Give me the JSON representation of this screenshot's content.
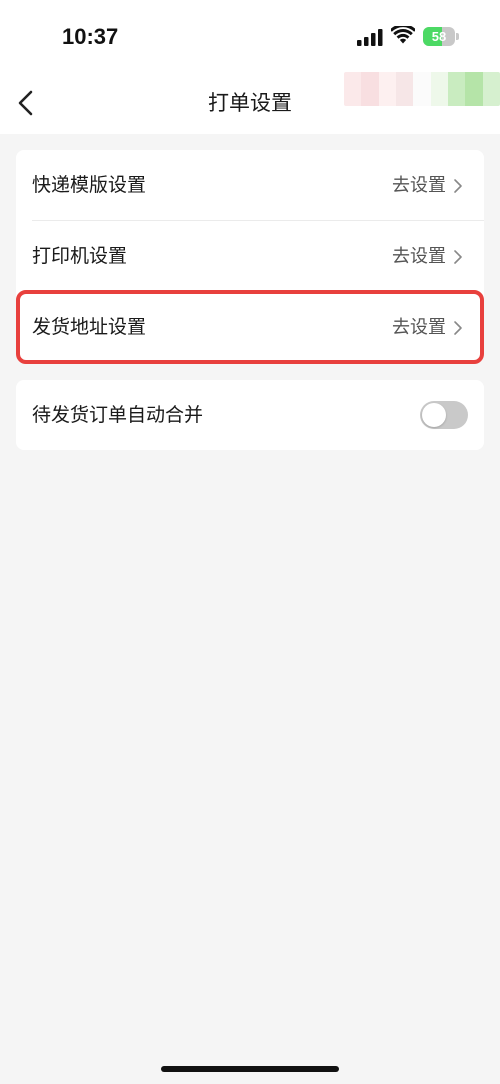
{
  "status_bar": {
    "time": "10:37",
    "battery_level": "58",
    "battery_fraction": 0.58,
    "icons": [
      "signal-icon",
      "wifi-icon",
      "battery-icon"
    ]
  },
  "nav": {
    "title": "打单设置",
    "back_icon": "chevron-left-icon"
  },
  "settings": {
    "items": [
      {
        "label": "快递模版设置",
        "action": "去设置"
      },
      {
        "label": "打印机设置",
        "action": "去设置"
      },
      {
        "label": "发货地址设置",
        "action": "去设置",
        "highlighted": true
      }
    ],
    "toggle_item": {
      "label": "待发货订单自动合并",
      "enabled": false
    }
  },
  "colors": {
    "background": "#f5f5f5",
    "card": "#ffffff",
    "highlight": "#e8403d",
    "battery": "#4cd964",
    "toggle_off": "#c9c9c9"
  }
}
